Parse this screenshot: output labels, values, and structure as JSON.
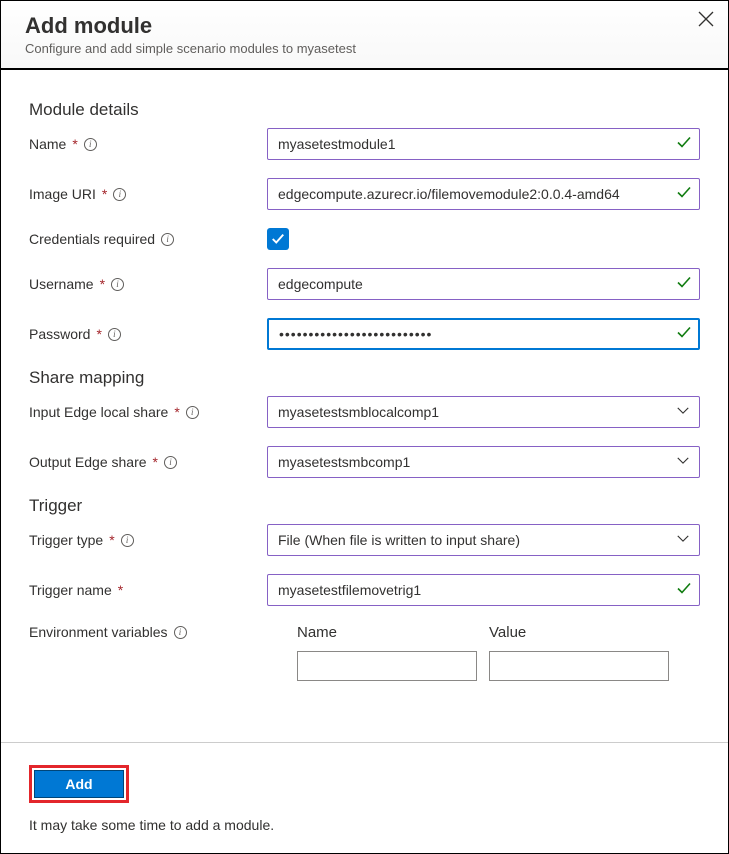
{
  "header": {
    "title": "Add module",
    "subtitle": "Configure and add simple scenario modules to myasetest"
  },
  "sections": {
    "details": "Module details",
    "share": "Share mapping",
    "trigger": "Trigger"
  },
  "labels": {
    "name": "Name",
    "image_uri": "Image URI",
    "creds": "Credentials required",
    "username": "Username",
    "password": "Password",
    "input_share": "Input Edge local share",
    "output_share": "Output Edge share",
    "trigger_type": "Trigger type",
    "trigger_name": "Trigger name",
    "env": "Environment variables",
    "env_name": "Name",
    "env_value": "Value"
  },
  "values": {
    "name": "myasetestmodule1",
    "image_uri": "edgecompute.azurecr.io/filemovemodule2:0.0.4-amd64",
    "creds_checked": true,
    "username": "edgecompute",
    "password": "••••••••••••••••••••••••••",
    "input_share": "myasetestsmblocalcomp1",
    "output_share": "myasetestsmbcomp1",
    "trigger_type": "File (When file is written to input share)",
    "trigger_name": "myasetestfilemovetrig1",
    "env_name": "",
    "env_value": ""
  },
  "footer": {
    "add_label": "Add",
    "note": "It may take some time to add a module."
  }
}
